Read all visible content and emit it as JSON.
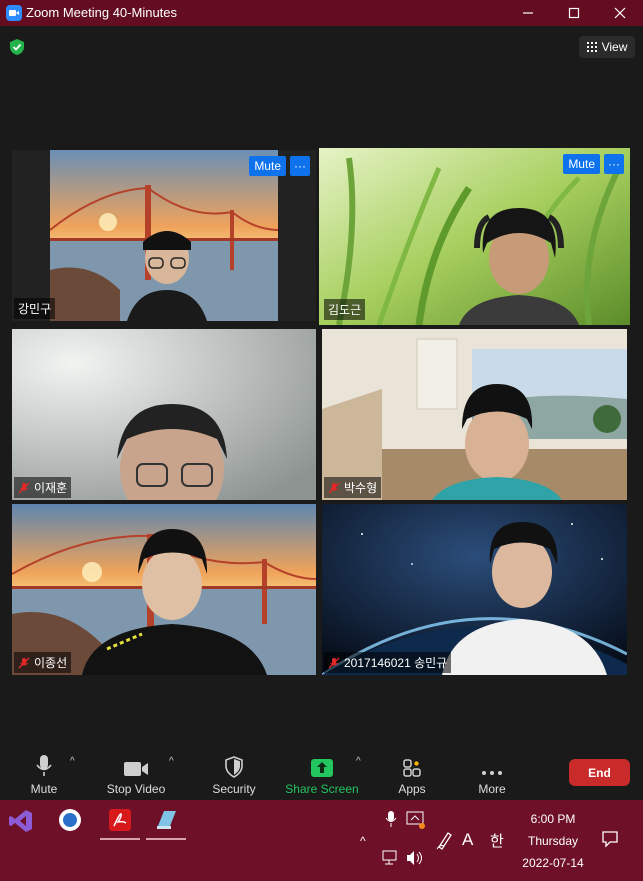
{
  "window": {
    "title": "Zoom Meeting 40-Minutes"
  },
  "header": {
    "view_label": "View"
  },
  "tiles": [
    {
      "name": "강민구",
      "mute_label": "Mute",
      "more_label": "···",
      "muted": false,
      "active": false
    },
    {
      "name": "김도근",
      "mute_label": "Mute",
      "more_label": "···",
      "muted": false,
      "active": true
    },
    {
      "name": "이재훈",
      "muted": true
    },
    {
      "name": "박수형",
      "muted": true
    },
    {
      "name": "이종선",
      "muted": true
    },
    {
      "name": "2017146021 송민규",
      "muted": true
    }
  ],
  "toolbar": {
    "mute_label": "Mute",
    "stop_video_label": "Stop Video",
    "security_label": "Security",
    "share_screen_label": "Share Screen",
    "apps_label": "Apps",
    "more_label": "More",
    "end_label": "End",
    "accent_share": "#22c55e",
    "end_color": "#c92a2a"
  },
  "taskbar": {
    "time": "6:00 PM",
    "day": "Thursday",
    "date": "2022-07-14",
    "ime_font_label": "A",
    "ime_lang_label": "한"
  },
  "colors": {
    "titlebar": "#640d21",
    "taskbar": "#6e1027",
    "zoom_blue": "#0e72ed",
    "active_border": "#e8f29a"
  }
}
